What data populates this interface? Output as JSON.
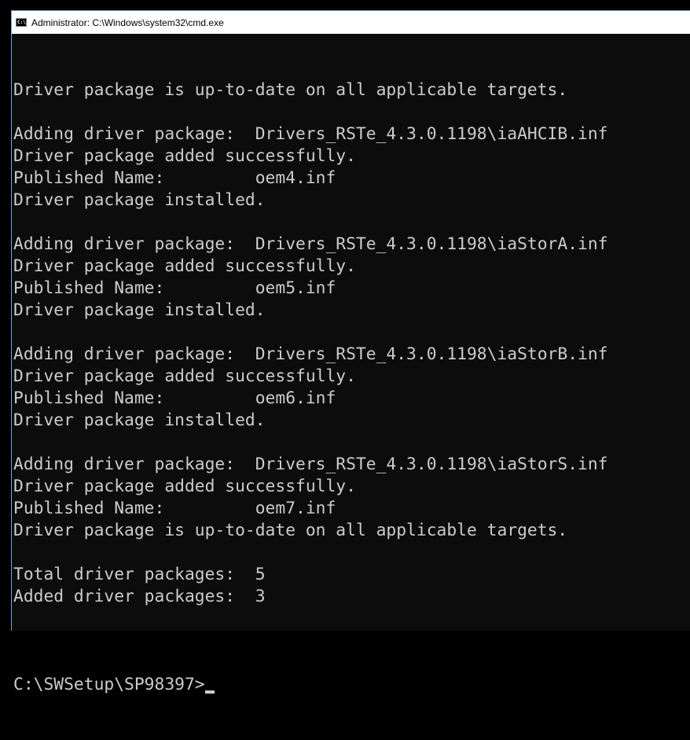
{
  "window": {
    "title": "Administrator: C:\\Windows\\system32\\cmd.exe",
    "title_icon": "cmd-icon",
    "title_icon_text": "C:\\"
  },
  "console": {
    "lines": [
      "Driver package is up-to-date on all applicable targets.",
      "",
      "Adding driver package:  Drivers_RSTe_4.3.0.1198\\iaAHCIB.inf",
      "Driver package added successfully.",
      "Published Name:         oem4.inf",
      "Driver package installed.",
      "",
      "Adding driver package:  Drivers_RSTe_4.3.0.1198\\iaStorA.inf",
      "Driver package added successfully.",
      "Published Name:         oem5.inf",
      "Driver package installed.",
      "",
      "Adding driver package:  Drivers_RSTe_4.3.0.1198\\iaStorB.inf",
      "Driver package added successfully.",
      "Published Name:         oem6.inf",
      "Driver package installed.",
      "",
      "Adding driver package:  Drivers_RSTe_4.3.0.1198\\iaStorS.inf",
      "Driver package added successfully.",
      "Published Name:         oem7.inf",
      "Driver package is up-to-date on all applicable targets.",
      "",
      "Total driver packages:  5",
      "Added driver packages:  3",
      ""
    ],
    "prompt": "C:\\SWSetup\\SP98397>"
  },
  "colors": {
    "background": "#0c0c0c",
    "text": "#cccccc",
    "titlebar": "#ffffff",
    "border": "#7aa7d6"
  }
}
